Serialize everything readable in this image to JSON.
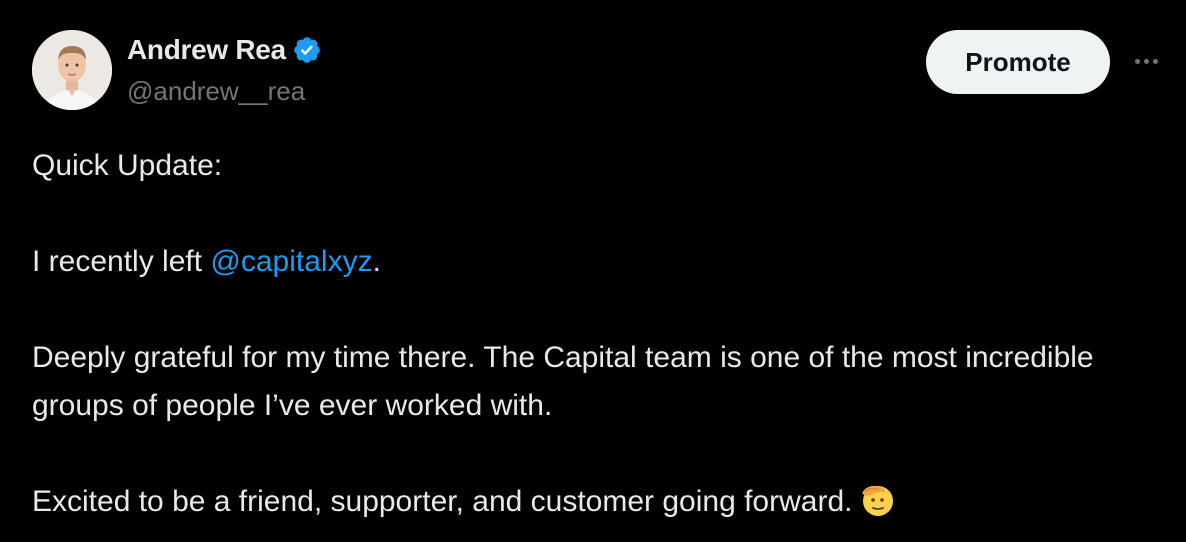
{
  "author": {
    "display_name": "Andrew Rea",
    "handle": "@andrew__rea",
    "verified": true,
    "verified_color": "#1d9bf0"
  },
  "actions": {
    "promote_label": "Promote",
    "more_icon": "more-horizontal-icon"
  },
  "tweet": {
    "line1": "Quick Update:",
    "line2_prefix": "I recently left ",
    "mention": "@capitalxyz",
    "line2_suffix": ".",
    "paragraph3": "Deeply grateful for my time there. The Capital team is one of the most incredible groups of people I’ve ever worked with.",
    "paragraph4": "Excited to be a friend, supporter, and customer going forward.",
    "emoji": "saluting-face-emoji"
  },
  "colors": {
    "background": "#000000",
    "text": "#e7e9ea",
    "secondary": "#71767b",
    "link": "#1d9bf0",
    "button_bg": "#eff3f4"
  }
}
